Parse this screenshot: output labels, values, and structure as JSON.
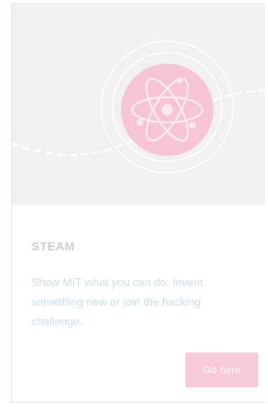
{
  "card": {
    "icon": "atom-icon",
    "title": "STEAM",
    "description": "Show MIT what you can do: Invent something new or join the hacking challenge.",
    "button_label": "Go here"
  },
  "colors": {
    "hero_background": "#f3f1ef",
    "icon_circle": "#f6c4d3",
    "button_background": "#f8c9d7",
    "title_text": "#c8ced6",
    "description_text": "#cfdde8"
  }
}
